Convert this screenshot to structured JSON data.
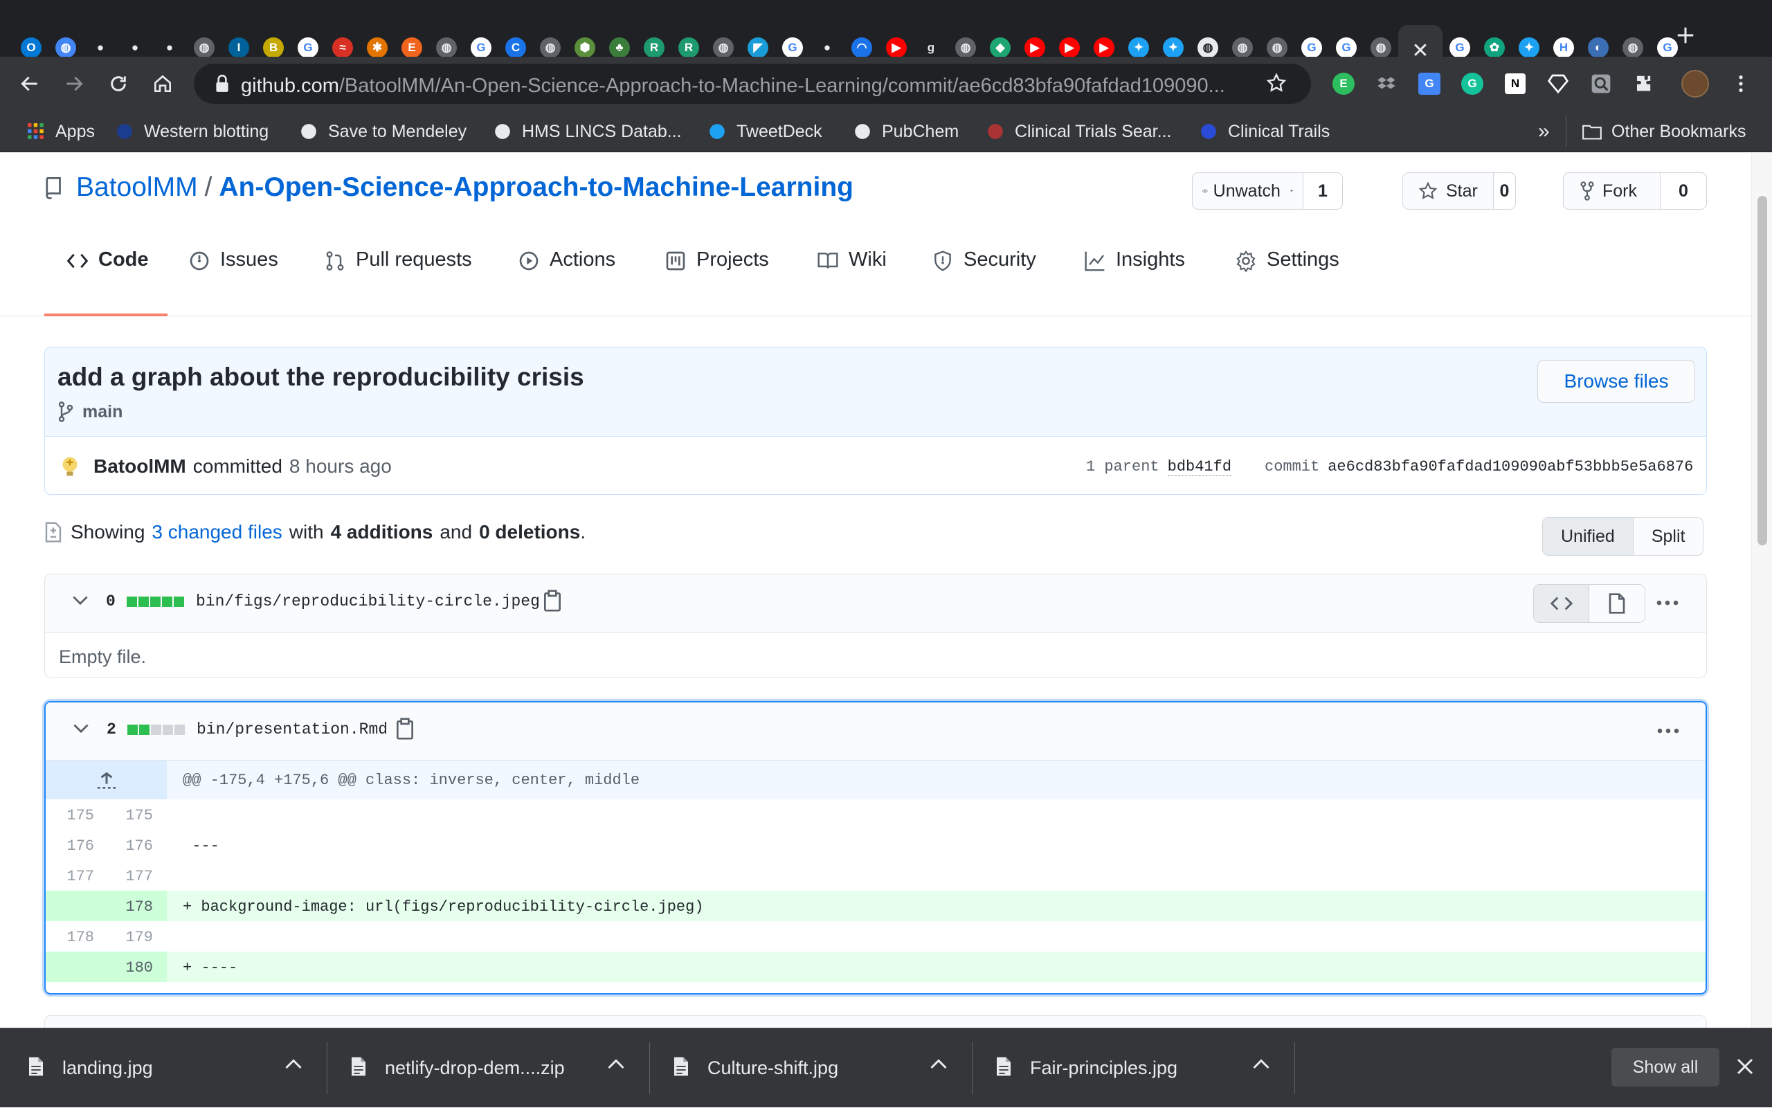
{
  "browser": {
    "tab_favicons": [
      {
        "icon": "outlook-icon",
        "color": "#0078d4",
        "glyph": "O"
      },
      {
        "icon": "globe-icon",
        "color": "#4285f4",
        "glyph": "◍"
      },
      {
        "icon": "github-icon",
        "color": "#202124",
        "glyph": "●"
      },
      {
        "icon": "github-icon",
        "color": "#202124",
        "glyph": "●"
      },
      {
        "icon": "github-icon",
        "color": "#202124",
        "glyph": "●"
      },
      {
        "icon": "globe-icon",
        "color": "#5f6368",
        "glyph": "◍"
      },
      {
        "icon": "ieee-icon",
        "color": "#00629b",
        "glyph": "I"
      },
      {
        "icon": "b-icon",
        "color": "#c5a800",
        "glyph": "B"
      },
      {
        "icon": "google-icon",
        "color": "#ffffff",
        "glyph": "G"
      },
      {
        "icon": "red-swoosh-icon",
        "color": "#d93025",
        "glyph": "≈"
      },
      {
        "icon": "puzzle-colored-icon",
        "color": "#e37400",
        "glyph": "✱"
      },
      {
        "icon": "etsy-icon",
        "color": "#f1641e",
        "glyph": "E"
      },
      {
        "icon": "globe-icon",
        "color": "#5f6368",
        "glyph": "◍"
      },
      {
        "icon": "google-icon",
        "color": "#ffffff",
        "glyph": "G"
      },
      {
        "icon": "c-icon",
        "color": "#1a73e8",
        "glyph": "C"
      },
      {
        "icon": "globe-icon",
        "color": "#5f6368",
        "glyph": "◍"
      },
      {
        "icon": "hex-icon",
        "color": "#5a8f3c",
        "glyph": "⬢"
      },
      {
        "icon": "tree-icon",
        "color": "#3b7d3b",
        "glyph": "♣"
      },
      {
        "icon": "r-icon",
        "color": "#1e9a6f",
        "glyph": "R"
      },
      {
        "icon": "r-icon",
        "color": "#1e9a6f",
        "glyph": "R"
      },
      {
        "icon": "globe-icon",
        "color": "#5f6368",
        "glyph": "◍"
      },
      {
        "icon": "triangle-icon",
        "color": "#1a9cd8",
        "glyph": "◤"
      },
      {
        "icon": "google-icon",
        "color": "#ffffff",
        "glyph": "G"
      },
      {
        "icon": "github-icon",
        "color": "#202124",
        "glyph": "●"
      },
      {
        "icon": "arc-icon",
        "color": "#1a73e8",
        "glyph": "◠"
      },
      {
        "icon": "youtube-icon",
        "color": "#ff0000",
        "glyph": "▶"
      },
      {
        "icon": "g-letter-icon",
        "color": "#202124",
        "glyph": "g"
      },
      {
        "icon": "globe-icon",
        "color": "#5f6368",
        "glyph": "◍"
      },
      {
        "icon": "diamond-icon",
        "color": "#1ea672",
        "glyph": "◆"
      },
      {
        "icon": "youtube-icon",
        "color": "#ff0000",
        "glyph": "▶"
      },
      {
        "icon": "youtube-icon",
        "color": "#ff0000",
        "glyph": "▶"
      },
      {
        "icon": "youtube-icon",
        "color": "#ff0000",
        "glyph": "▶"
      },
      {
        "icon": "twitter-icon",
        "color": "#1da1f2",
        "glyph": "✦"
      },
      {
        "icon": "twitter-icon",
        "color": "#1da1f2",
        "glyph": "✦"
      },
      {
        "icon": "globe-icon",
        "color": "#e8eaed",
        "glyph": "◍"
      },
      {
        "icon": "globe-icon",
        "color": "#5f6368",
        "glyph": "◍"
      },
      {
        "icon": "globe-icon",
        "color": "#5f6368",
        "glyph": "◍"
      },
      {
        "icon": "google-icon",
        "color": "#ffffff",
        "glyph": "G"
      },
      {
        "icon": "google-icon",
        "color": "#ffffff",
        "glyph": "G"
      },
      {
        "icon": "globe-icon",
        "color": "#5f6368",
        "glyph": "◍"
      },
      {
        "icon": "close-icon",
        "color": "#35363a",
        "glyph": "✕",
        "active": true
      },
      {
        "icon": "google-icon",
        "color": "#ffffff",
        "glyph": "G"
      },
      {
        "icon": "openai-icon",
        "color": "#10a37f",
        "glyph": "✿"
      },
      {
        "icon": "twitter-icon",
        "color": "#1da1f2",
        "glyph": "✦"
      },
      {
        "icon": "h-icon",
        "color": "#ffffff",
        "glyph": "H"
      },
      {
        "icon": "blue-red-icon",
        "color": "#3c6eb4",
        "glyph": "◐"
      },
      {
        "icon": "globe-icon",
        "color": "#5f6368",
        "glyph": "◍"
      },
      {
        "icon": "google-icon",
        "color": "#ffffff",
        "glyph": "G"
      }
    ],
    "url_host": "github.com",
    "url_path": "/BatoolMM/An-Open-Science-Approach-to-Machine-Learning/commit/ae6cd83bfa90fafdad109090...",
    "bookmarks": [
      {
        "label": "Apps",
        "icon": "apps-grid-icon"
      },
      {
        "label": "Western blotting",
        "icon": "bird-icon"
      },
      {
        "label": "Save to Mendeley",
        "icon": "globe-icon"
      },
      {
        "label": "HMS LINCS Datab...",
        "icon": "globe-icon"
      },
      {
        "label": "TweetDeck",
        "icon": "twitter-icon"
      },
      {
        "label": "PubChem",
        "icon": "pubchem-icon"
      },
      {
        "label": "Clinical Trials Sear...",
        "icon": "clinical-trials-icon"
      },
      {
        "label": "Clinical Trails",
        "icon": "ct-icon"
      }
    ],
    "bookmarks_overflow": "»",
    "other_bookmarks": "Other Bookmarks"
  },
  "repo": {
    "owner": "BatoolMM",
    "slash": "/",
    "name": "An-Open-Science-Approach-to-Machine-Learning",
    "watch_label": "Unwatch",
    "watch_count": "1",
    "star_label": "Star",
    "star_count": "0",
    "fork_label": "Fork",
    "fork_count": "0",
    "tabs": [
      {
        "label": "Code",
        "icon": "code-icon",
        "selected": true
      },
      {
        "label": "Issues",
        "icon": "issue-icon"
      },
      {
        "label": "Pull requests",
        "icon": "pull-request-icon"
      },
      {
        "label": "Actions",
        "icon": "play-icon"
      },
      {
        "label": "Projects",
        "icon": "project-icon"
      },
      {
        "label": "Wiki",
        "icon": "book-icon"
      },
      {
        "label": "Security",
        "icon": "shield-icon"
      },
      {
        "label": "Insights",
        "icon": "graph-icon"
      },
      {
        "label": "Settings",
        "icon": "gear-icon"
      }
    ]
  },
  "commit": {
    "title": "add a graph about the reproducibility crisis",
    "branch": "main",
    "browse_label": "Browse files",
    "author": "BatoolMM",
    "action": "committed",
    "time": "8 hours ago",
    "parent_label": "1 parent",
    "parent_sha": "bdb41fd",
    "commit_label": "commit",
    "sha": "ae6cd83bfa90fafdad109090abf53bbb5e5a6876"
  },
  "summary": {
    "showing": "Showing",
    "changed_files": "3 changed files",
    "with": "with",
    "additions": "4 additions",
    "and": "and",
    "deletions": "0 deletions",
    "period": ".",
    "unified": "Unified",
    "split": "Split"
  },
  "files": [
    {
      "count": "0",
      "bar": [
        "g",
        "g",
        "g",
        "g",
        "g"
      ],
      "path": "bin/figs/reproducibility-circle.jpeg",
      "empty_text": "Empty file."
    },
    {
      "count": "2",
      "bar": [
        "g",
        "g",
        "e",
        "e",
        "e"
      ],
      "path": "bin/presentation.Rmd",
      "hunk": "@@ -175,4 +175,6 @@ class: inverse, center, middle",
      "lines": [
        {
          "old": "175",
          "new": "175",
          "code": "",
          "type": "ctx"
        },
        {
          "old": "176",
          "new": "176",
          "code": " ---",
          "type": "ctx"
        },
        {
          "old": "177",
          "new": "177",
          "code": "",
          "type": "ctx"
        },
        {
          "old": "",
          "new": "178",
          "code": "+ background-image: url(figs/reproducibility-circle.jpeg)",
          "type": "add"
        },
        {
          "old": "178",
          "new": "179",
          "code": "",
          "type": "ctx"
        },
        {
          "old": "",
          "new": "180",
          "code": "+ ----",
          "type": "add"
        }
      ]
    }
  ],
  "downloads": [
    {
      "name": "landing.jpg",
      "icon": "file-icon"
    },
    {
      "name": "netlify-drop-dem....zip",
      "icon": "file-icon"
    },
    {
      "name": "Culture-shift.jpg",
      "icon": "file-icon"
    },
    {
      "name": "Fair-principles.jpg",
      "icon": "file-icon"
    }
  ],
  "show_all": "Show all",
  "colors": {
    "link": "#0366d6",
    "add_bg": "#e6ffed",
    "add_gutter": "#cdffd8",
    "diffstat_green": "#2cbe4e",
    "tab_underline": "#f9826c",
    "chrome_dark": "#202124",
    "chrome_toolbar": "#35363a"
  }
}
